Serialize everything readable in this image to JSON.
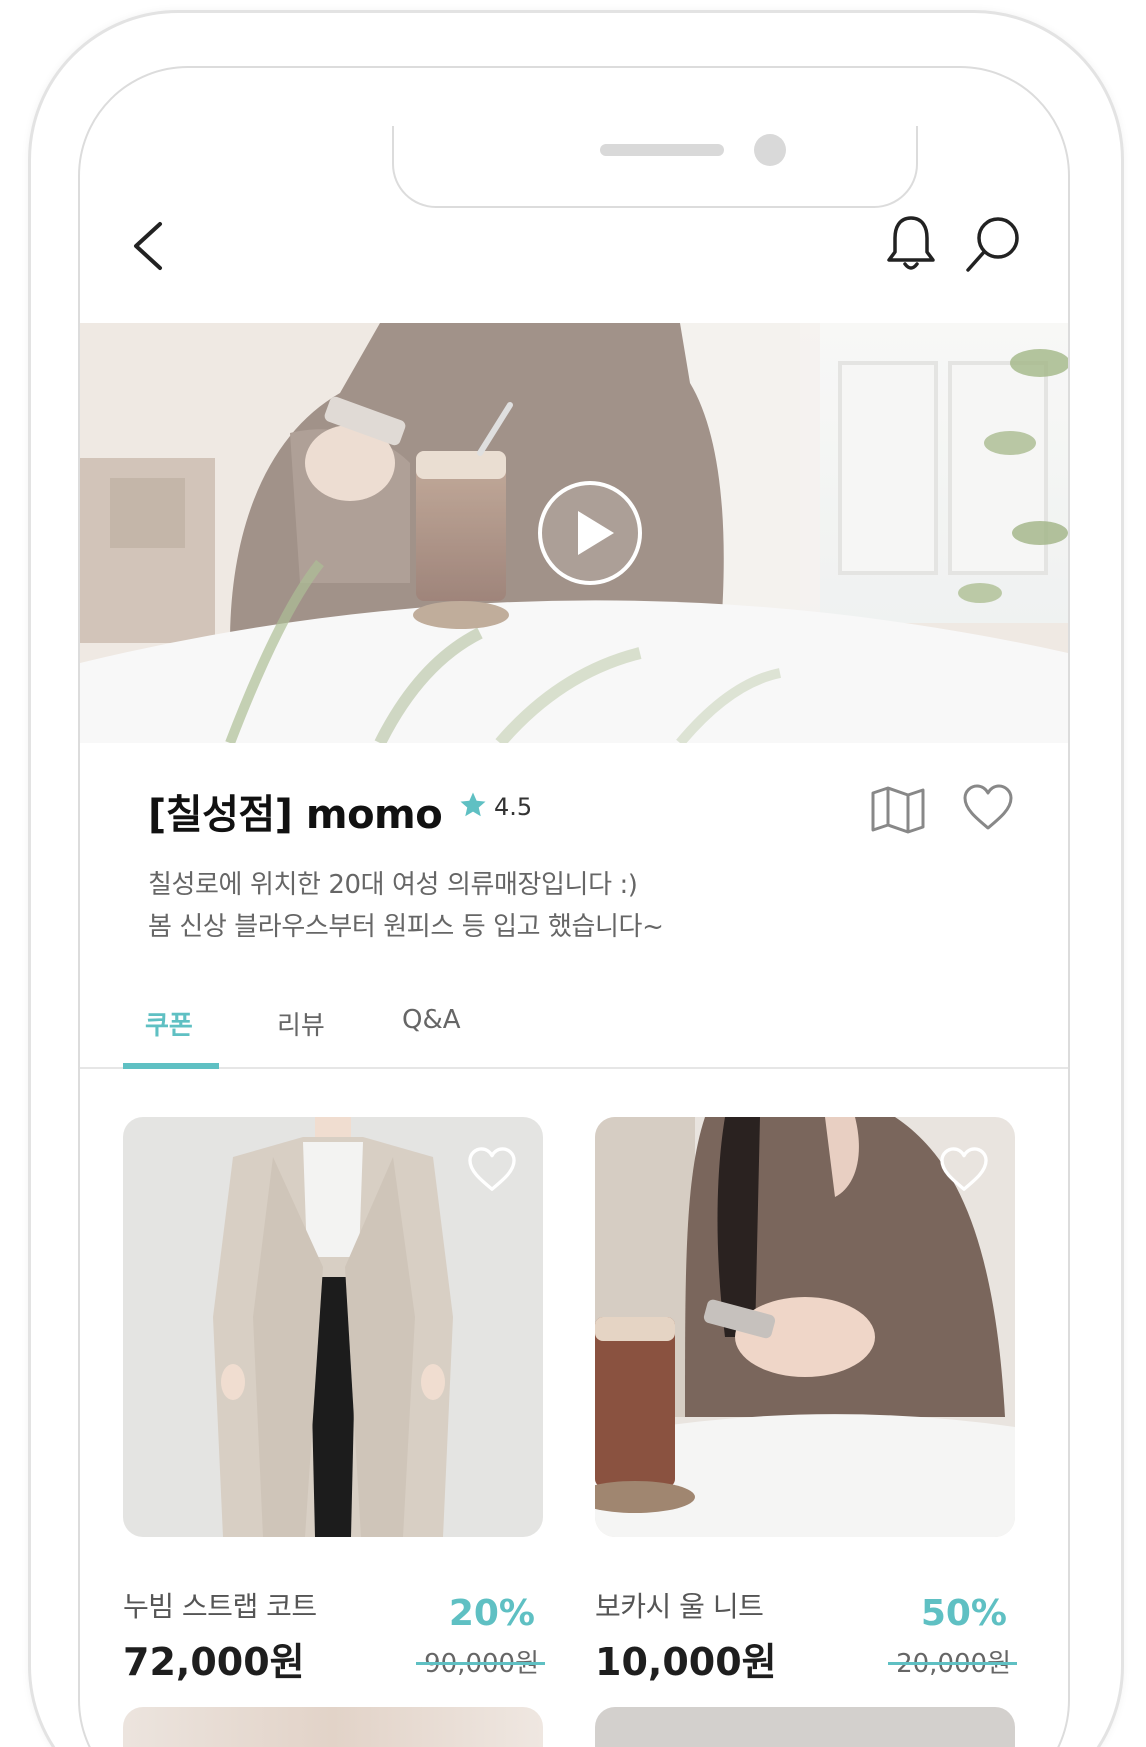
{
  "header": {
    "back_icon": "chevron-left-icon",
    "bell_icon": "bell-icon",
    "search_icon": "search-icon"
  },
  "hero": {
    "play_icon": "play-icon"
  },
  "store": {
    "name": "[칠성점] momo",
    "rating": "4.5",
    "rating_icon": "star-icon",
    "map_icon": "map-icon",
    "favorite_icon": "heart-icon",
    "description": [
      "칠성로에 위치한 20대 여성 의류매장입니다 :)",
      "봄 신상 블라우스부터 원피스 등 입고 했습니다~"
    ]
  },
  "tabs": [
    {
      "label": "쿠폰",
      "active": true
    },
    {
      "label": "리뷰",
      "active": false
    },
    {
      "label": "Q&A",
      "active": false
    }
  ],
  "products": [
    {
      "name": "누빔 스트랩 코트",
      "price": "72,000원",
      "discount": "20%",
      "original_price": "90,000원"
    },
    {
      "name": "보카시 울 니트",
      "price": "10,000원",
      "discount": "50%",
      "original_price": "20,000원"
    }
  ],
  "colors": {
    "accent": "#5fc0c3",
    "text_dark": "#111111",
    "text_muted": "#666666"
  }
}
